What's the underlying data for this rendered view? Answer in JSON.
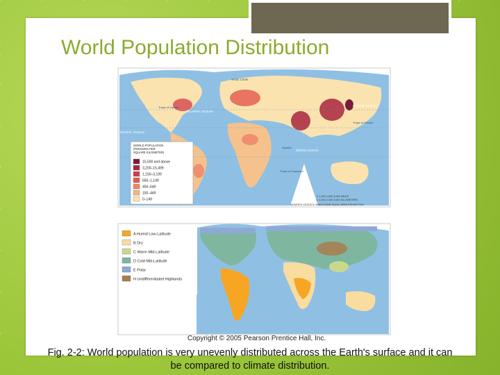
{
  "slide": {
    "title": "World Population Distribution",
    "copyright": "Copyright © 2005 Pearson Prentice Hall, Inc.",
    "caption": "Fig. 2-2: World population is very unevenly distributed across the Earth's surface and it can be compared to climate distribution."
  },
  "population_map": {
    "legend_title": [
      "WORLD POPULATION",
      "(PERSONS PER",
      "SQUARE KILOMETER)"
    ],
    "legend": [
      {
        "label": "15,500 and above",
        "color": "#7b1a3a"
      },
      {
        "label": "3,200–15,499",
        "color": "#a7263e"
      },
      {
        "label": "1,150–3,199",
        "color": "#d4394a"
      },
      {
        "label": "650–1,149",
        "color": "#e3584d"
      },
      {
        "label": "450–649",
        "color": "#ee8567"
      },
      {
        "label": "150–449",
        "color": "#f5b285"
      },
      {
        "label": "0–149",
        "color": "#fbe3b0"
      }
    ],
    "labels": {
      "arctic_circle": "Arctic Circle",
      "atlantic": "ATLANTIC OCEAN",
      "pacific_left": "PACIFIC OCEAN",
      "pacific_right": "PACIFIC OCEAN",
      "indian": "INDIAN OCEAN",
      "tropic_cancer_l": "Tropic of Cancer",
      "tropic_cancer_r": "Tropic of Cancer",
      "tropic_capricorn": "Tropic of Capricorn",
      "equator": "Equator",
      "scale_miles": "0  1,000  2,000  3,000 MILES",
      "scale_km": "0  1,000 2,000  3,000 KILOMETERS",
      "projection": "MODIFIED GOODE'S HOMOLOSINE EQUAL-AREA PROJECTION"
    }
  },
  "climate_map": {
    "legend": [
      {
        "label": "A  Humid Low-Latitude",
        "color": "#f6a623"
      },
      {
        "label": "B  Dry",
        "color": "#f8dca0"
      },
      {
        "label": "C  Warm Mid-Latitude",
        "color": "#c9d98c"
      },
      {
        "label": "D  Cold Mid-Latitude",
        "color": "#7fb6a0"
      },
      {
        "label": "E  Polar",
        "color": "#8fa9d6"
      },
      {
        "label": "H  Undifferentiated Highlands",
        "color": "#a97d4f"
      }
    ]
  },
  "colors": {
    "ocean": "#8fc0e3",
    "slide_bg": "#9cc63a",
    "title": "#8cab2d",
    "tab": "#6e6751"
  }
}
